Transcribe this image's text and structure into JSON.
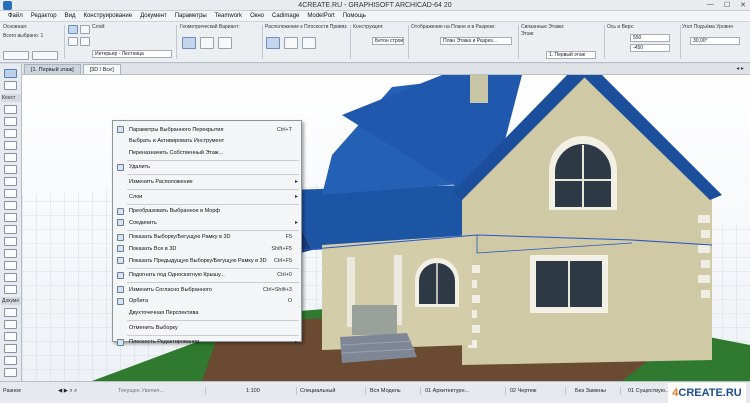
{
  "window": {
    "title": "4CREATE.RU - GRAPHISOFT ARCHICAD-64 20",
    "controls": [
      "—",
      "☐",
      "✕"
    ]
  },
  "menubar": {
    "items": [
      "Файл",
      "Редактор",
      "Вид",
      "Конструирование",
      "Документ",
      "Параметры",
      "Teamwork",
      "Окно",
      "Cadimage",
      "ModelPort",
      "Помощь"
    ]
  },
  "infobox": {
    "main_label": "Основная:",
    "selected_label": "Всего выбрано: 1",
    "layer_label": "Слой:",
    "layer_value": "Интерьер - Лестница",
    "geometry_label": "Геометрический Вариант:",
    "ref_plane_label": "Расположение к Плоскости Привязки:",
    "construction_label": "Конструкция:",
    "construction_value": "Бетон строите...",
    "display_label": "Отображение на Плане и в Разрезе:",
    "display_value": "План Этажа и Разрез...",
    "linked_floors_label": "Связанные Этажи:",
    "floor_label": "Этаж:",
    "floor_value": "1. Первый этаж",
    "thickness_label": "Ось и Верх:",
    "thickness_top": "550",
    "thickness_bottom": "-450",
    "angle_label": "Угол Подъёма Уровня",
    "angle_value": "30,00°"
  },
  "toolbox": {
    "sections": [
      "Конст",
      "Докуме",
      "Разное"
    ]
  },
  "tabs": [
    {
      "label": "[1. Первый этаж]",
      "active": false
    },
    {
      "label": "[3D / Все]",
      "active": true
    }
  ],
  "context_menu": {
    "items": [
      {
        "label": "Параметры Выбранного Перекрытия",
        "shortcut": "Ctrl+T",
        "icon": true,
        "submenu": false
      },
      {
        "label": "Выбрать и Активировать Инструмент",
        "shortcut": "",
        "icon": false,
        "submenu": false
      },
      {
        "label": "Переназначить Собственный Этаж...",
        "shortcut": "",
        "icon": false,
        "submenu": false
      },
      {
        "label": "Удалить",
        "shortcut": "",
        "icon": true,
        "submenu": false,
        "sep_before": true
      },
      {
        "label": "Изменить Расположение",
        "shortcut": "",
        "icon": false,
        "submenu": true,
        "sep_before": true
      },
      {
        "label": "Слои",
        "shortcut": "",
        "icon": false,
        "submenu": true,
        "sep_before": true
      },
      {
        "label": "Преобразовать Выбранное в Морф",
        "shortcut": "",
        "icon": true,
        "submenu": false,
        "sep_before": true
      },
      {
        "label": "Соединить",
        "shortcut": "",
        "icon": true,
        "submenu": true
      },
      {
        "label": "Показать Выборку/Бегущую Рамку в 3D",
        "shortcut": "F5",
        "icon": true,
        "submenu": false,
        "sep_before": true
      },
      {
        "label": "Показать Все в 3D",
        "shortcut": "Shift+F5",
        "icon": true,
        "submenu": false
      },
      {
        "label": "Показать Предыдущую Выборку/Бегущую Рамку в 3D",
        "shortcut": "Ctrl+F5",
        "icon": true,
        "submenu": false
      },
      {
        "label": "Подогнать под Односкатную Крышу...",
        "shortcut": "Ctrl+0",
        "icon": true,
        "submenu": false,
        "sep_before": true
      },
      {
        "label": "Изменить Согласно Выбранного",
        "shortcut": "Ctrl+Shift+3",
        "icon": true,
        "submenu": false,
        "sep_before": true
      },
      {
        "label": "Орбита",
        "shortcut": "O",
        "icon": true,
        "submenu": false
      },
      {
        "label": "Двухточечная Перспектива",
        "shortcut": "",
        "icon": false,
        "submenu": false
      },
      {
        "label": "Отменить Выборку",
        "shortcut": "",
        "icon": false,
        "submenu": false,
        "sep_before": true
      },
      {
        "label": "Плоскость Редактирования",
        "shortcut": "",
        "icon": true,
        "submenu": true,
        "sep_before": true
      }
    ]
  },
  "statusbar": {
    "items": [
      {
        "text": "Разное"
      },
      {
        "text": "Текущее Увелич..."
      },
      {
        "text": "1:100"
      },
      {
        "text": "Специальный"
      },
      {
        "text": "Вся Модель"
      },
      {
        "text": "01 Архитектурн..."
      },
      {
        "text": "02 Чертеж"
      },
      {
        "text": "Без Замены"
      },
      {
        "text": "01 Существую..."
      }
    ],
    "logo_num": "4",
    "logo_text": "CREATE.RU"
  }
}
